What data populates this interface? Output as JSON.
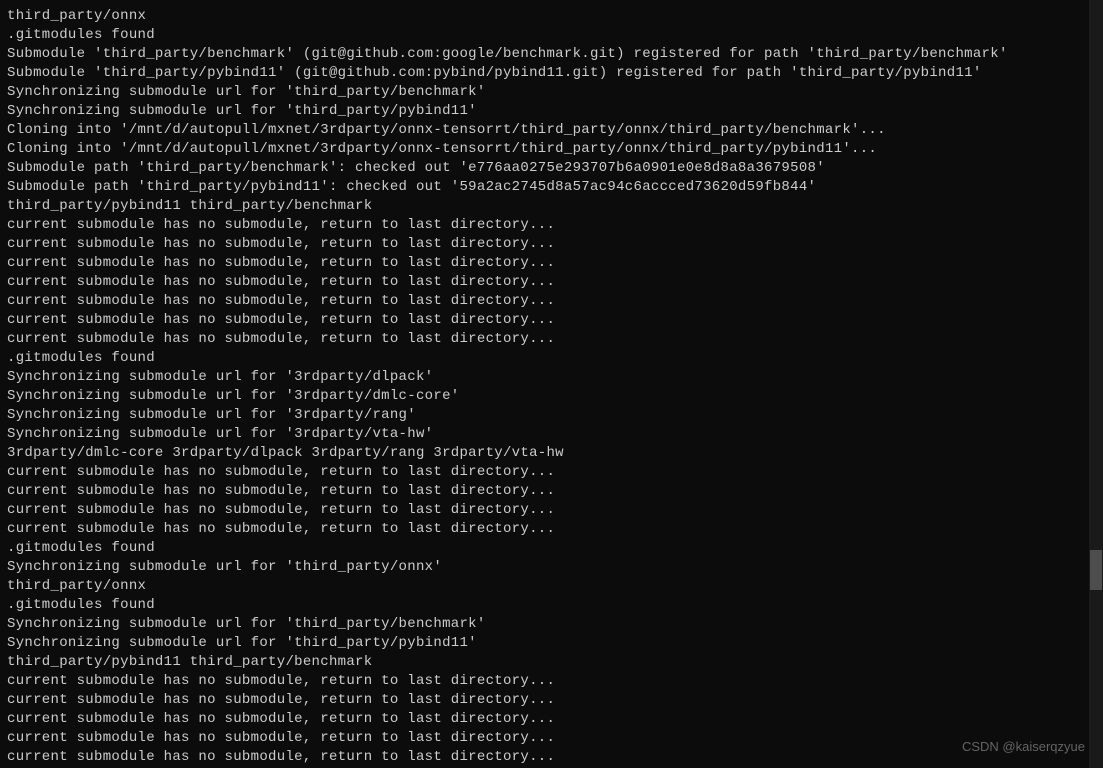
{
  "terminal": {
    "lines": [
      "third_party/onnx",
      ".gitmodules found",
      "Submodule 'third_party/benchmark' (git@github.com:google/benchmark.git) registered for path 'third_party/benchmark'",
      "Submodule 'third_party/pybind11' (git@github.com:pybind/pybind11.git) registered for path 'third_party/pybind11'",
      "Synchronizing submodule url for 'third_party/benchmark'",
      "Synchronizing submodule url for 'third_party/pybind11'",
      "Cloning into '/mnt/d/autopull/mxnet/3rdparty/onnx-tensorrt/third_party/onnx/third_party/benchmark'...",
      "Cloning into '/mnt/d/autopull/mxnet/3rdparty/onnx-tensorrt/third_party/onnx/third_party/pybind11'...",
      "Submodule path 'third_party/benchmark': checked out 'e776aa0275e293707b6a0901e0e8d8a8a3679508'",
      "Submodule path 'third_party/pybind11': checked out '59a2ac2745d8a57ac94c6accced73620d59fb844'",
      "third_party/pybind11 third_party/benchmark",
      "current submodule has no submodule, return to last directory...",
      "current submodule has no submodule, return to last directory...",
      "current submodule has no submodule, return to last directory...",
      "current submodule has no submodule, return to last directory...",
      "current submodule has no submodule, return to last directory...",
      "current submodule has no submodule, return to last directory...",
      "current submodule has no submodule, return to last directory...",
      ".gitmodules found",
      "Synchronizing submodule url for '3rdparty/dlpack'",
      "Synchronizing submodule url for '3rdparty/dmlc-core'",
      "Synchronizing submodule url for '3rdparty/rang'",
      "Synchronizing submodule url for '3rdparty/vta-hw'",
      "3rdparty/dmlc-core 3rdparty/dlpack 3rdparty/rang 3rdparty/vta-hw",
      "current submodule has no submodule, return to last directory...",
      "current submodule has no submodule, return to last directory...",
      "current submodule has no submodule, return to last directory...",
      "current submodule has no submodule, return to last directory...",
      ".gitmodules found",
      "Synchronizing submodule url for 'third_party/onnx'",
      "third_party/onnx",
      ".gitmodules found",
      "Synchronizing submodule url for 'third_party/benchmark'",
      "Synchronizing submodule url for 'third_party/pybind11'",
      "third_party/pybind11 third_party/benchmark",
      "current submodule has no submodule, return to last directory...",
      "current submodule has no submodule, return to last directory...",
      "current submodule has no submodule, return to last directory...",
      "current submodule has no submodule, return to last directory...",
      "current submodule has no submodule, return to last directory..."
    ]
  },
  "watermark": "CSDN @kaiserqzyue"
}
